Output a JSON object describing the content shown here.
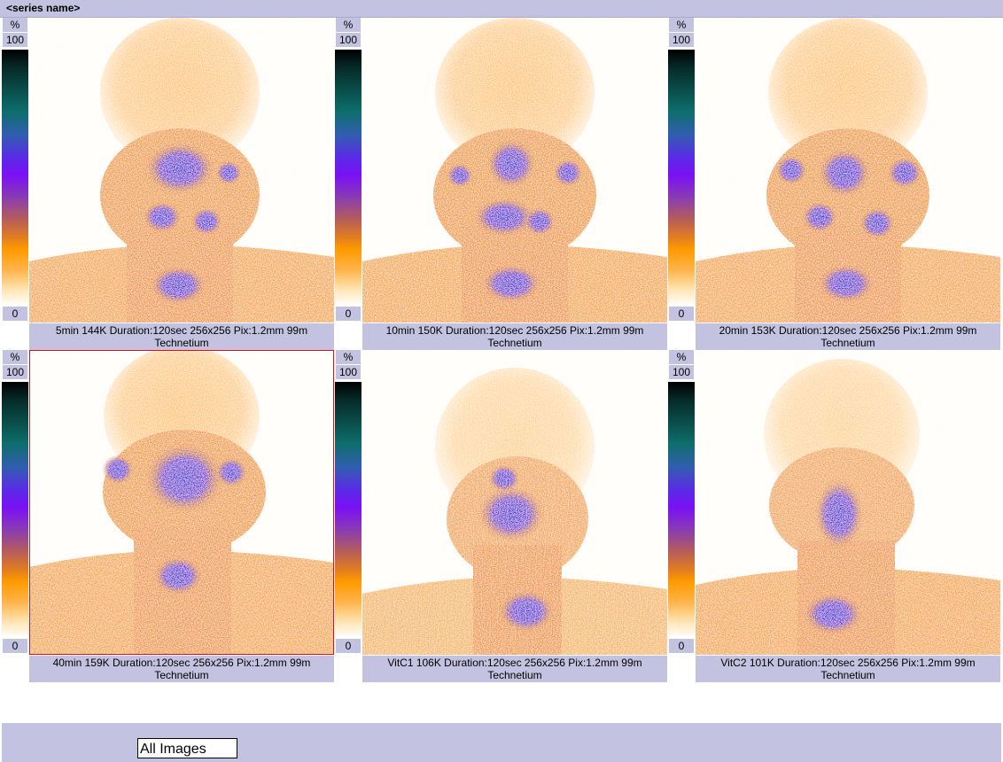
{
  "window": {
    "series_name": "<series name>"
  },
  "scale": {
    "unit": "%",
    "max": "100",
    "min": "0"
  },
  "images": [
    {
      "line1": "5min 144K Duration:120sec 256x256 Pix:1.2mm 99m",
      "line2": "Technetium"
    },
    {
      "line1": "10min 150K Duration:120sec 256x256 Pix:1.2mm 99m",
      "line2": "Technetium"
    },
    {
      "line1": "20min 153K Duration:120sec 256x256 Pix:1.2mm 99m",
      "line2": "Technetium"
    },
    {
      "line1": "40min 159K Duration:120sec 256x256 Pix:1.2mm 99m",
      "line2": "Technetium"
    },
    {
      "line1": "VitC1 106K Duration:120sec 256x256 Pix:1.2mm 99m",
      "line2": "Technetium"
    },
    {
      "line1": "VitC2 101K Duration:120sec 256x256 Pix:1.2mm 99m",
      "line2": "Technetium"
    }
  ],
  "footer": {
    "selection": "All Images"
  },
  "colors": {
    "panel": "#c3c3e1",
    "hot": "#f08a10",
    "uptake": "#6a2ae0",
    "selected_border": "#d11111"
  }
}
